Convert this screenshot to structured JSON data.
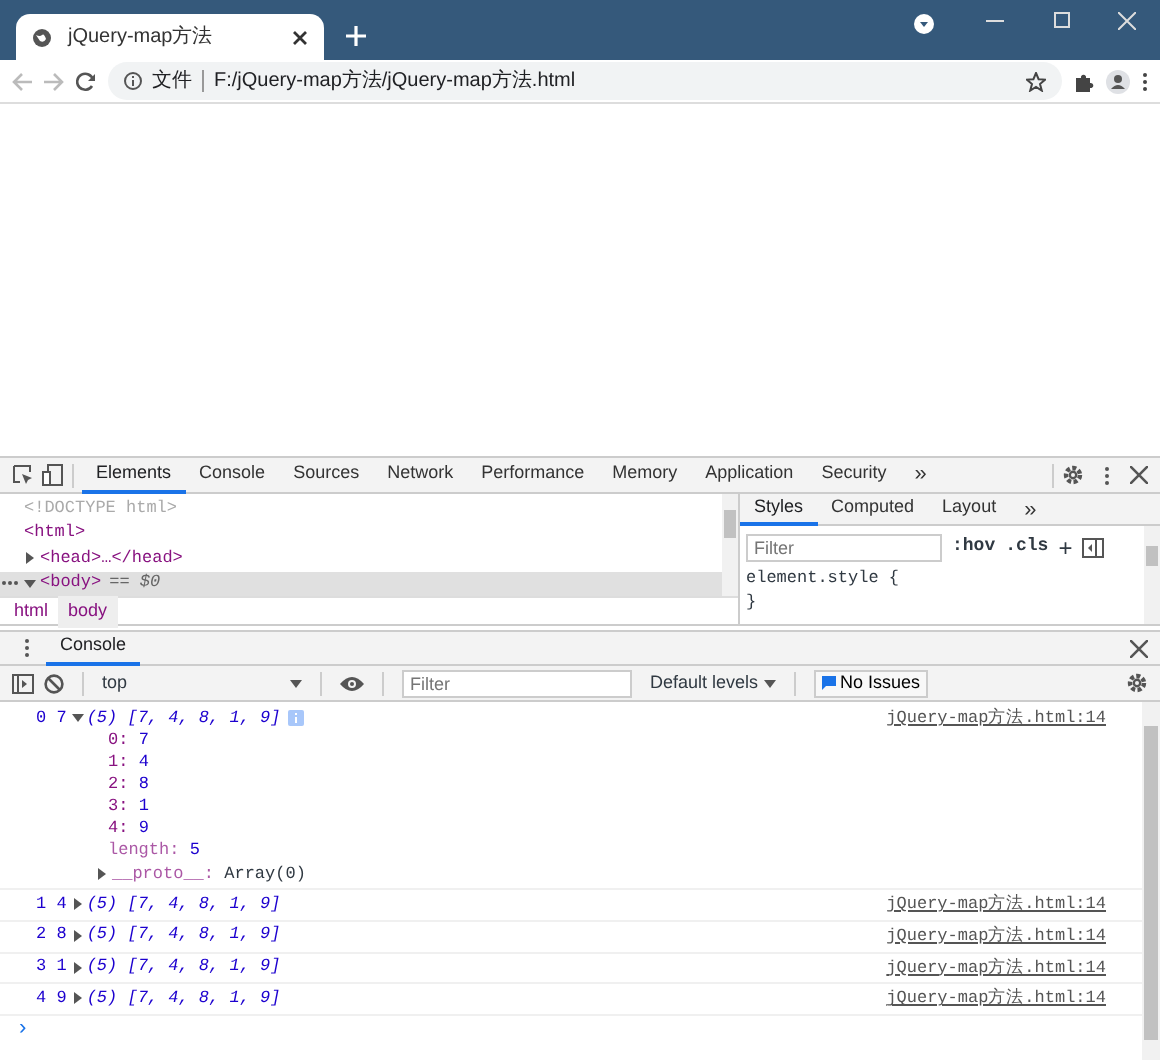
{
  "browser": {
    "tab_title": "jQuery-map方法",
    "security_label": "文件",
    "address": "F:/jQuery-map方法/jQuery-map方法.html"
  },
  "devtools": {
    "tabs": [
      {
        "label": "Elements",
        "selected": true
      },
      {
        "label": "Console",
        "selected": false
      },
      {
        "label": "Sources",
        "selected": false
      },
      {
        "label": "Network",
        "selected": false
      },
      {
        "label": "Performance",
        "selected": false
      },
      {
        "label": "Memory",
        "selected": false
      },
      {
        "label": "Application",
        "selected": false
      },
      {
        "label": "Security",
        "selected": false
      }
    ],
    "more_tabs": "»",
    "dom_lines": [
      {
        "text": "<!DOCTYPE html>",
        "kind": "doctype",
        "selected": false
      },
      {
        "text": "<html>",
        "kind": "tag",
        "selected": false
      },
      {
        "text": "<head>…</head>",
        "kind": "toggle",
        "expanded": false,
        "selected": false
      },
      {
        "text": "<body>",
        "kind": "toggle",
        "expanded": true,
        "selected": true,
        "note": "== $0"
      }
    ],
    "breadcrumbs": [
      {
        "label": "html",
        "selected": false
      },
      {
        "label": "body",
        "selected": true
      }
    ],
    "styles_tabs": [
      {
        "label": "Styles",
        "selected": true
      },
      {
        "label": "Computed",
        "selected": false
      },
      {
        "label": "Layout",
        "selected": false
      }
    ],
    "styles_more": "»",
    "styles_filter": {
      "placeholder": "Filter"
    },
    "hov": ":hov",
    "cls": ".cls",
    "plus": "+",
    "style_rule": [
      "element.style {",
      "}"
    ]
  },
  "drawer": {
    "tab": "Console",
    "context": "top",
    "filter": {
      "placeholder": "Filter"
    },
    "levels": "Default levels",
    "issues": "No Issues",
    "messages": [
      {
        "prefix": "0 7",
        "summary": "(5) [7, 4, 8, 1, 9]",
        "expanded": true,
        "source": "jQuery-map方法.html:14",
        "properties": [
          {
            "key": "0:",
            "value": "7",
            "kind": "index"
          },
          {
            "key": "1:",
            "value": "4",
            "kind": "index"
          },
          {
            "key": "2:",
            "value": "8",
            "kind": "index"
          },
          {
            "key": "3:",
            "value": "1",
            "kind": "index"
          },
          {
            "key": "4:",
            "value": "9",
            "kind": "index"
          },
          {
            "key": "length:",
            "value": "5",
            "kind": "meta"
          }
        ],
        "proto": {
          "key": "__proto__:",
          "value": "Array(0)"
        }
      },
      {
        "prefix": "1 4",
        "summary": "(5) [7, 4, 8, 1, 9]",
        "expanded": false,
        "source": "jQuery-map方法.html:14"
      },
      {
        "prefix": "2 8",
        "summary": "(5) [7, 4, 8, 1, 9]",
        "expanded": false,
        "source": "jQuery-map方法.html:14"
      },
      {
        "prefix": "3 1",
        "summary": "(5) [7, 4, 8, 1, 9]",
        "expanded": false,
        "source": "jQuery-map方法.html:14"
      },
      {
        "prefix": "4 9",
        "summary": "(5) [7, 4, 8, 1, 9]",
        "expanded": false,
        "source": "jQuery-map方法.html:14"
      }
    ],
    "prompt": "›"
  }
}
